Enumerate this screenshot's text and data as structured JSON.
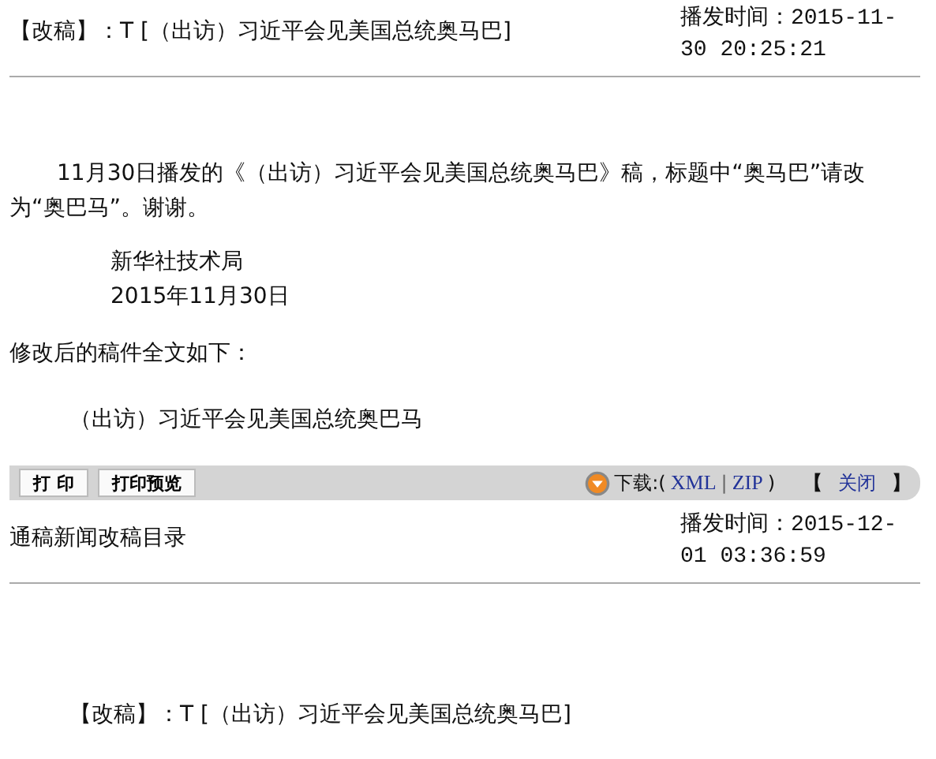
{
  "sections": [
    {
      "heading": "【改稿】：T [（出访）习近平会见美国总统奥马巴]",
      "time": "播发时间：2015-11-30 20:25:21"
    },
    {
      "heading": "通稿新闻改稿目录",
      "time": "播发时间：2015-12-01 03:36:59"
    }
  ],
  "notice": {
    "paragraph": "11月30日播发的《（出访）习近平会见美国总统奥马巴》稿，标题中“奥马巴”请改为“奥巴马”。谢谢。",
    "signature": [
      "新华社技术局",
      "2015年11月30日"
    ],
    "lead": "修改后的稿件全文如下：",
    "corrected_title": "（出访）习近平会见美国总统奥巴马"
  },
  "toolbar": {
    "buttons": [
      "打 印",
      "打印预览"
    ],
    "download_label": "下载:(",
    "formats": [
      "XML",
      "ZIP"
    ],
    "separator": "|",
    "close_paren": ")",
    "bracket_open": "【",
    "close_link": "关闭",
    "bracket_close": "】"
  },
  "next_item": "【改稿】：T [（出访）习近平会见美国总统奥马巴]"
}
